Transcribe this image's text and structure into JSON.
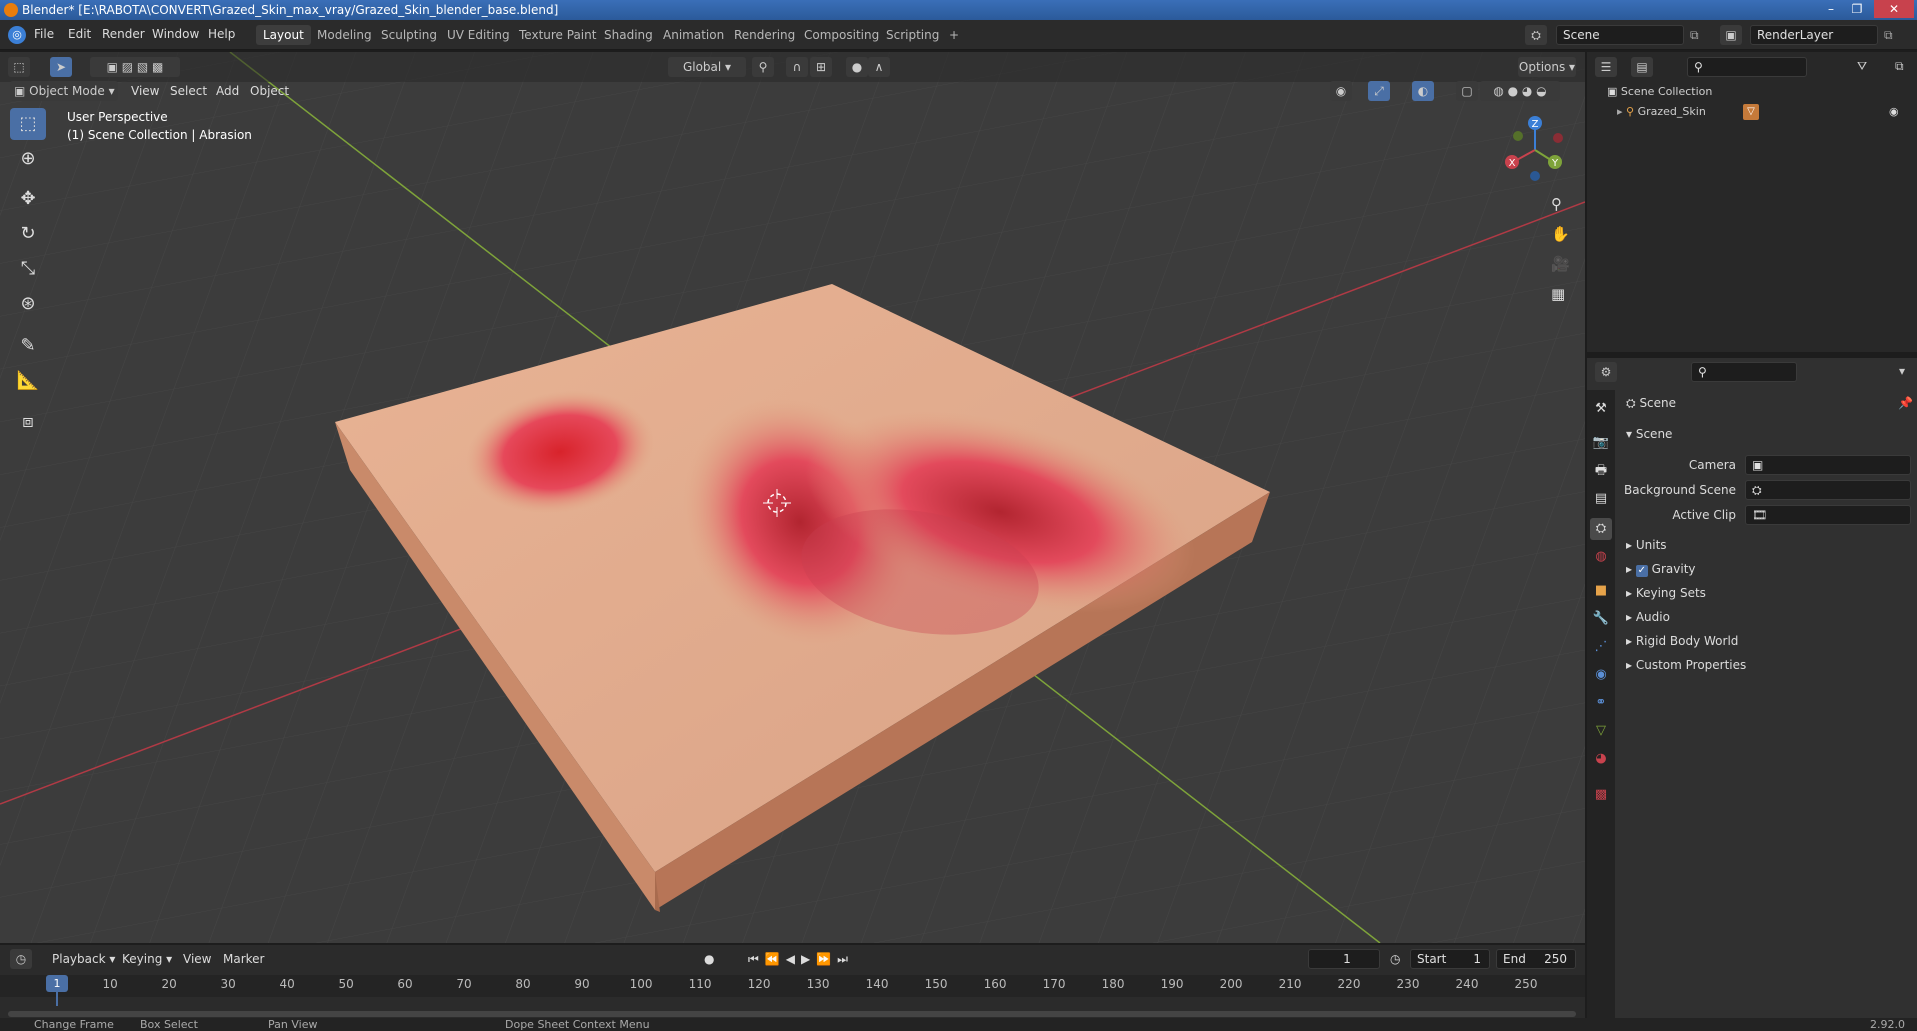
{
  "title_bar": {
    "title": "Blender* [E:\\RABOTA\\CONVERT\\Grazed_Skin_max_vray/Grazed_Skin_blender_base.blend]"
  },
  "menu": {
    "items": [
      "File",
      "Edit",
      "Render",
      "Window",
      "Help"
    ]
  },
  "workspaces": [
    "Layout",
    "Modeling",
    "Sculpting",
    "UV Editing",
    "Texture Paint",
    "Shading",
    "Animation",
    "Rendering",
    "Compositing",
    "Scripting",
    "+"
  ],
  "scene_field": "Scene",
  "renderlayer_field": "RenderLayer",
  "viewport_header": {
    "mode": "Object Mode",
    "menus": [
      "View",
      "Select",
      "Add",
      "Object"
    ],
    "orientation": "Global",
    "options": "Options"
  },
  "viewport_info": {
    "line1": "User Perspective",
    "line2": "(1) Scene Collection | Abrasion"
  },
  "gizmo": {
    "x": "X",
    "y": "Y",
    "z": "Z"
  },
  "outliner": {
    "root": "Scene Collection",
    "items": [
      {
        "label": "Grazed_Skin"
      }
    ]
  },
  "properties": {
    "context": "Scene",
    "panel_title": "Scene",
    "camera_label": "Camera",
    "background_scene_label": "Background Scene",
    "active_clip_label": "Active Clip",
    "sections": [
      "Units",
      "Gravity",
      "Keying Sets",
      "Audio",
      "Rigid Body World",
      "Custom Properties"
    ]
  },
  "timeline": {
    "menus": [
      "Playback",
      "Keying",
      "View",
      "Marker"
    ],
    "current_frame": "1",
    "start_label": "Start",
    "start": "1",
    "end_label": "End",
    "end": "250",
    "ticks": [
      "1",
      "10",
      "20",
      "30",
      "40",
      "50",
      "60",
      "70",
      "80",
      "90",
      "100",
      "110",
      "120",
      "130",
      "140",
      "150",
      "160",
      "170",
      "180",
      "190",
      "200",
      "210",
      "220",
      "230",
      "240",
      "250"
    ]
  },
  "status_bar": {
    "items": [
      "Change Frame",
      "Box Select",
      "Pan View",
      "Dope Sheet Context Menu"
    ],
    "version": "2.92.0"
  },
  "colors": {
    "accent": "#4a6fa5",
    "x_axis": "#c8424d",
    "y_axis": "#7ea33a",
    "z_axis": "#3b7fd6",
    "skin": "#e0a07e"
  }
}
